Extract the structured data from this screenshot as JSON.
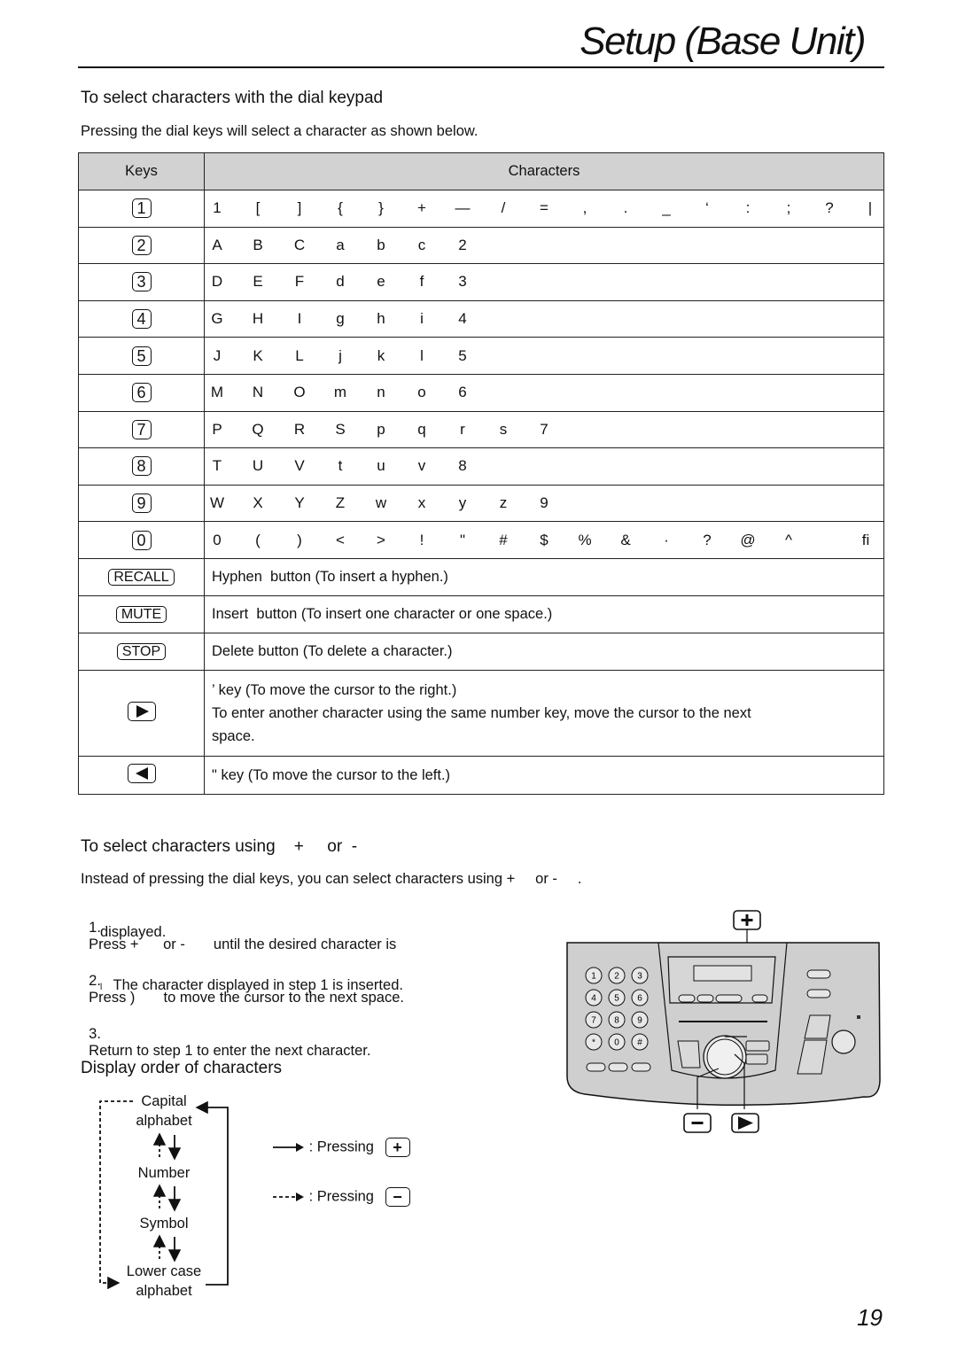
{
  "header": {
    "title": "Setup (Base Unit)"
  },
  "section_dial": {
    "heading": "To select characters with the dial keypad",
    "intro": "Pressing the dial keys will select a character as shown below."
  },
  "table": {
    "headers": {
      "keys": "Keys",
      "characters": "Characters"
    },
    "char_rows": [
      {
        "key": "1",
        "chars": [
          "1",
          "[",
          "]",
          "{",
          "}",
          "+",
          "—",
          "/",
          "=",
          ",",
          ".",
          "_",
          "‘",
          ":",
          ";",
          "?",
          "|"
        ]
      },
      {
        "key": "2",
        "chars": [
          "A",
          "B",
          "C",
          "a",
          "b",
          "c",
          "2"
        ]
      },
      {
        "key": "3",
        "chars": [
          "D",
          "E",
          "F",
          "d",
          "e",
          "f",
          "3"
        ]
      },
      {
        "key": "4",
        "chars": [
          "G",
          "H",
          "I",
          "g",
          "h",
          "i",
          "4"
        ]
      },
      {
        "key": "5",
        "chars": [
          "J",
          "K",
          "L",
          "j",
          "k",
          "l",
          "5"
        ]
      },
      {
        "key": "6",
        "chars": [
          "M",
          "N",
          "O",
          "m",
          "n",
          "o",
          "6"
        ]
      },
      {
        "key": "7",
        "chars": [
          "P",
          "Q",
          "R",
          "S",
          "p",
          "q",
          "r",
          "s",
          "7"
        ]
      },
      {
        "key": "8",
        "chars": [
          "T",
          "U",
          "V",
          "t",
          "u",
          "v",
          "8"
        ]
      },
      {
        "key": "9",
        "chars": [
          "W",
          "X",
          "Y",
          "Z",
          "w",
          "x",
          "y",
          "z",
          "9"
        ]
      },
      {
        "key": "0",
        "chars": [
          "0",
          "(",
          ")",
          "<",
          ">",
          "!",
          "\"",
          "#",
          "$",
          "%",
          "&",
          "·",
          "?",
          "@",
          "^",
          "",
          "",
          "fi"
        ]
      }
    ],
    "func_rows": [
      {
        "key": "RECALL",
        "desc": "Hyphen  button (To insert a hyphen.)"
      },
      {
        "key": "MUTE",
        "desc": "Insert  button (To insert one character or one space.)"
      },
      {
        "key": "STOP",
        "desc": "Delete button (To delete a character.)"
      }
    ],
    "right_row": {
      "line1": "’   key (To move the cursor to the right.)",
      "line2": "To enter another character using the same number key, move the cursor to the next",
      "line3": "space."
    },
    "left_row": {
      "desc": "\"   key (To move the cursor to the left.)"
    }
  },
  "section_plusminus": {
    "heading": "To select characters using    +     or  -",
    "intro": "Instead of pressing the dial keys, you can select characters using +     or -     .",
    "steps": [
      {
        "num": "1.",
        "text": "Press +      or -       until the desired character is",
        "cont": "displayed."
      },
      {
        "num": "2.",
        "text": "Press )       to move the cursor to the next space.",
        "bullet": "l",
        "sub": "The character displayed in step 1 is inserted."
      },
      {
        "num": "3.",
        "text": "Return to step 1 to enter the next character."
      }
    ]
  },
  "device": {
    "keypad": [
      "1",
      "2",
      "3",
      "4",
      "5",
      "6",
      "7",
      "8",
      "9",
      "*",
      "0",
      "#"
    ],
    "callout_plus": "+",
    "callout_minus": "−"
  },
  "section_order": {
    "heading": "Display order of characters",
    "flow": [
      "Capital\nalphabet",
      "Number",
      "Symbol",
      "Lower case\nalphabet"
    ],
    "flow_lines": {
      "capital_1": "Capital",
      "capital_2": "alphabet",
      "number": "Number",
      "symbol": "Symbol",
      "lower_1": "Lower case",
      "lower_2": "alphabet"
    },
    "legend": [
      {
        "label": ": Pressing",
        "key": "+"
      },
      {
        "label": ": Pressing",
        "key": "−"
      }
    ]
  },
  "footer": {
    "page_number": "19"
  }
}
